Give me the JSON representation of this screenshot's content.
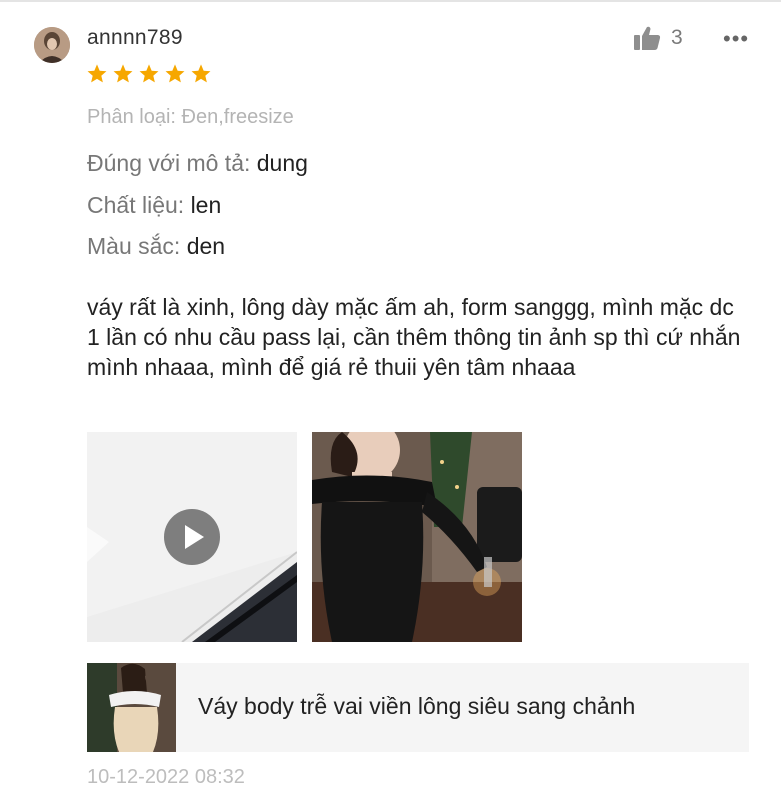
{
  "review": {
    "username": "annnn789",
    "like_count": "3",
    "more_label": "•••",
    "rating": 5,
    "variant": "Phân loại: Đen,freesize",
    "attributes": [
      {
        "label": "Đúng với mô tả:",
        "value": "dung"
      },
      {
        "label": "Chất liệu:",
        "value": "len"
      },
      {
        "label": "Màu sắc:",
        "value": "den"
      }
    ],
    "comment": "váy rất là xinh, lông dày mặc ấm ah, form sanggg, mình mặc dc 1 lần có nhu cầu pass lại, cần thêm thông tin ảnh sp thì cứ nhắn mình nhaaa, mình để giá rẻ thuii yên tâm nhaaa",
    "media": [
      {
        "type": "video",
        "icon": "play-icon"
      },
      {
        "type": "image",
        "subject": "woman in black off-shoulder fur dress"
      }
    ],
    "product": {
      "name": "Váy body trễ vai viền lông siêu sang chảnh"
    },
    "timestamp": "10-12-2022 08:32"
  },
  "colors": {
    "star": "#f6a700",
    "text": "#222222",
    "muted": "#777777",
    "variant": "#b4b4b4",
    "product_bg": "#f5f5f5"
  }
}
